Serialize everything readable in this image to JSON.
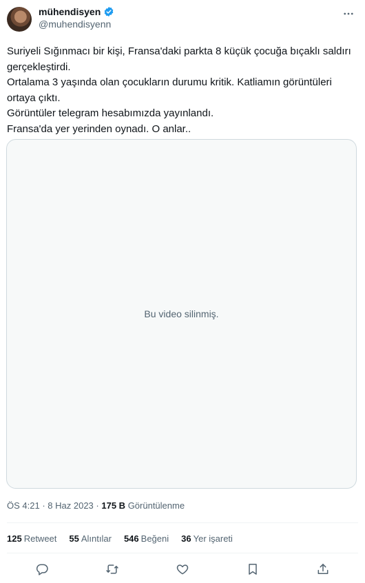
{
  "author": {
    "display_name": "mühendisyen",
    "handle": "@muhendisyenn",
    "verified_icon": "verified-badge-icon",
    "accent": "#1d9bf0"
  },
  "tweet": {
    "lines": [
      "Suriyeli Sığınmacı bir kişi, Fransa'daki parkta 8 küçük çocuğa bıçaklı saldırı gerçekleştirdi.",
      "Ortalama 3 yaşında olan çocukların durumu kritik. Katliamın görüntüleri ortaya çıktı.",
      "Görüntüler telegram hesabımızda yayınlandı.",
      "Fransa'da yer yerinden oynadı. O anlar.."
    ]
  },
  "media": {
    "message": "Bu video silinmiş."
  },
  "meta": {
    "time": "ÖS 4:21",
    "sep1": "·",
    "date": "8 Haz 2023",
    "sep2": "·",
    "views_count": "175 B",
    "views_label": "Görüntülenme"
  },
  "stats": {
    "retweets": {
      "count": "125",
      "label": "Retweet"
    },
    "quotes": {
      "count": "55",
      "label": "Alıntılar"
    },
    "likes": {
      "count": "546",
      "label": "Beğeni"
    },
    "bookmarks": {
      "count": "36",
      "label": "Yer işareti"
    }
  },
  "actions": {
    "reply_icon": "reply-icon",
    "retweet_icon": "retweet-icon",
    "like_icon": "like-icon",
    "bookmark_icon": "bookmark-icon",
    "share_icon": "share-icon"
  }
}
